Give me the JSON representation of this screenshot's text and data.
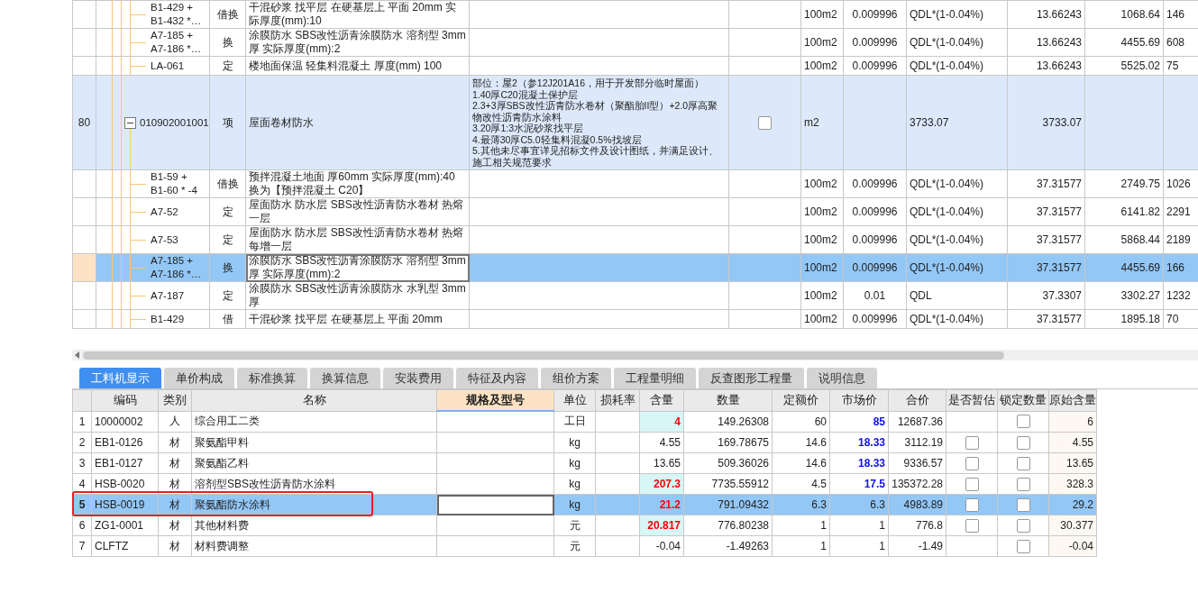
{
  "top_table": {
    "rows": [
      {
        "kind": "sub",
        "selected": false,
        "code": "B1-429 +\nB1-432 *…",
        "type": "借换",
        "name": "干混砂浆 找平层 在硬基层上 平面 20mm  实际厚度(mm):10",
        "unit": "100m2",
        "content": "0.009996",
        "formula": "QDL*(1-0.04%)",
        "quantity": "13.66243",
        "price": "1068.64",
        "total": "146"
      },
      {
        "kind": "sub",
        "selected": false,
        "code": "A7-185 +\nA7-186 *…",
        "type": "换",
        "name": "涂膜防水 SBS改性沥青涂膜防水 溶剂型 3mm厚  实际厚度(mm):2",
        "unit": "100m2",
        "content": "0.009996",
        "formula": "QDL*(1-0.04%)",
        "quantity": "13.66243",
        "price": "4455.69",
        "total": "608"
      },
      {
        "kind": "sub",
        "selected": false,
        "code": "LA-061",
        "type": "定",
        "name": "楼地面保温 轻集料混凝土 厚度(mm) 100",
        "unit": "100m2",
        "content": "0.009996",
        "formula": "QDL*(1-0.04%)",
        "quantity": "13.66243",
        "price": "5525.02",
        "total": "75"
      },
      {
        "kind": "item",
        "selected": false,
        "expanded": true,
        "number": "80",
        "code": "010902001001",
        "type": "项",
        "name": "屋面卷材防水",
        "description": "部位：屋2（参12J201A16，用于开发部分临时屋面）\n1.40厚C20混凝土保护层\n2.3+3厚SBS改性沥青防水卷材（聚酯胎II型）+2.0厚高聚物改性沥青防水涂料\n3.20厚1:3水泥砂浆找平层\n4.最薄30厚C5.0轻集料混凝0.5%找坡层\n5.其他未尽事宜详见招标文件及设计图纸，并满足设计、施工相关规范要求",
        "checked": false,
        "unit": "m2",
        "formula": "3733.07",
        "quantity": "3733.07"
      },
      {
        "kind": "sub",
        "selected": false,
        "code": "B1-59 +\nB1-60 * -4",
        "type": "借换",
        "name": "预拌混凝土地面 厚60mm  实际厚度(mm):40 换为【预拌混凝土 C20】",
        "unit": "100m2",
        "content": "0.009996",
        "formula": "QDL*(1-0.04%)",
        "quantity": "37.31577",
        "price": "2749.75",
        "total": "1026"
      },
      {
        "kind": "sub",
        "selected": false,
        "code": "A7-52",
        "type": "定",
        "name": "屋面防水 防水层 SBS改性沥青防水卷材 热熔一层",
        "unit": "100m2",
        "content": "0.009996",
        "formula": "QDL*(1-0.04%)",
        "quantity": "37.31577",
        "price": "6141.82",
        "total": "2291"
      },
      {
        "kind": "sub",
        "selected": false,
        "code": "A7-53",
        "type": "定",
        "name": "屋面防水 防水层 SBS改性沥青防水卷材 热熔每增一层",
        "unit": "100m2",
        "content": "0.009996",
        "formula": "QDL*(1-0.04%)",
        "quantity": "37.31577",
        "price": "5868.44",
        "total": "2189"
      },
      {
        "kind": "sub",
        "selected": true,
        "code": "A7-185 +\nA7-186 *…",
        "type": "换",
        "name": "涂膜防水 SBS改性沥青涂膜防水 溶剂型 3mm厚  实际厚度(mm):2",
        "unit": "100m2",
        "content": "0.009996",
        "formula": "QDL*(1-0.04%)",
        "quantity": "37.31577",
        "price": "4455.69",
        "total": "166"
      },
      {
        "kind": "sub",
        "selected": false,
        "code": "A7-187",
        "type": "定",
        "name": "涂膜防水 SBS改性沥青涂膜防水 水乳型 3mm厚",
        "unit": "100m2",
        "content": "0.01",
        "formula": "QDL",
        "quantity": "37.3307",
        "price": "3302.27",
        "total": "1232"
      },
      {
        "kind": "sub",
        "selected": false,
        "code": "B1-429",
        "type": "借",
        "name": "干混砂浆 找平层 在硬基层上 平面 20mm",
        "unit": "100m2",
        "content": "0.009996",
        "formula": "QDL*(1-0.04%)",
        "quantity": "37.31577",
        "price": "1895.18",
        "total": "70"
      }
    ]
  },
  "tabs": [
    {
      "label": "工料机显示",
      "selected": true
    },
    {
      "label": "单价构成",
      "selected": false
    },
    {
      "label": "标准换算",
      "selected": false
    },
    {
      "label": "换算信息",
      "selected": false
    },
    {
      "label": "安装费用",
      "selected": false
    },
    {
      "label": "特征及内容",
      "selected": false
    },
    {
      "label": "组价方案",
      "selected": false
    },
    {
      "label": "工程量明细",
      "selected": false
    },
    {
      "label": "反查图形工程量",
      "selected": false
    },
    {
      "label": "说明信息",
      "selected": false
    }
  ],
  "resource_table": {
    "columns": [
      {
        "label": "编码",
        "selected": false
      },
      {
        "label": "类别",
        "selected": false
      },
      {
        "label": "名称",
        "selected": false
      },
      {
        "label": "规格及型号",
        "selected": true
      },
      {
        "label": "单位",
        "selected": false
      },
      {
        "label": "损耗率",
        "selected": false
      },
      {
        "label": "含量",
        "selected": false
      },
      {
        "label": "数量",
        "selected": false
      },
      {
        "label": "定额价",
        "selected": false
      },
      {
        "label": "市场价",
        "selected": false
      },
      {
        "label": "合价",
        "selected": false
      },
      {
        "label": "是否暂估",
        "selected": false
      },
      {
        "label": "锁定数量",
        "selected": false
      },
      {
        "label": "原始含量",
        "selected": false
      }
    ],
    "rows": [
      {
        "number": "1",
        "code": "10000002",
        "type": "人",
        "name": "综合用工二类",
        "unit": "工日",
        "content": "4",
        "content_changed": true,
        "quantity": "149.26308",
        "quota_price": "60",
        "market_price": "85",
        "price_changed": true,
        "total": "12687.36",
        "locked": false,
        "original": "6",
        "selected": false,
        "outlined": false
      },
      {
        "number": "2",
        "code": "EB1-0126",
        "type": "材",
        "name": "聚氨酯甲料",
        "unit": "kg",
        "content": "4.55",
        "content_changed": false,
        "quantity": "169.78675",
        "quota_price": "14.6",
        "market_price": "18.33",
        "price_changed": true,
        "total": "3112.19",
        "provisional": false,
        "locked": false,
        "original": "4.55",
        "selected": false,
        "outlined": false
      },
      {
        "number": "3",
        "code": "EB1-0127",
        "type": "材",
        "name": "聚氨酯乙料",
        "unit": "kg",
        "content": "13.65",
        "content_changed": false,
        "quantity": "509.36026",
        "quota_price": "14.6",
        "market_price": "18.33",
        "price_changed": true,
        "total": "9336.57",
        "provisional": false,
        "locked": false,
        "original": "13.65",
        "selected": false,
        "outlined": false
      },
      {
        "number": "4",
        "code": "HSB-0020",
        "type": "材",
        "name": "溶剂型SBS改性沥青防水涂料",
        "unit": "kg",
        "content": "207.3",
        "content_changed": true,
        "quantity": "7735.55912",
        "quota_price": "4.5",
        "market_price": "17.5",
        "price_changed": true,
        "total": "135372.28",
        "provisional": false,
        "locked": false,
        "original": "328.3",
        "selected": false,
        "outlined": false
      },
      {
        "number": "5",
        "code": "HSB-0019",
        "type": "材",
        "name": "聚氨酯防水涂料",
        "unit": "kg",
        "content": "21.2",
        "content_changed": true,
        "quantity": "791.09432",
        "quota_price": "6.3",
        "market_price": "6.3",
        "price_changed": false,
        "total": "4983.89",
        "provisional": false,
        "locked": false,
        "original": "29.2",
        "selected": true,
        "outlined": true
      },
      {
        "number": "6",
        "code": "ZG1-0001",
        "type": "材",
        "name": "其他材料费",
        "unit": "元",
        "content": "20.817",
        "content_changed": true,
        "quantity": "776.80238",
        "quota_price": "1",
        "market_price": "1",
        "price_changed": false,
        "total": "776.8",
        "provisional": false,
        "locked": false,
        "original": "30.377",
        "selected": false,
        "outlined": false
      },
      {
        "number": "7",
        "code": "CLFTZ",
        "type": "材",
        "name": "材料费调整",
        "unit": "元",
        "content": "-0.04",
        "content_changed": false,
        "quantity": "-1.49263",
        "quota_price": "1",
        "market_price": "1",
        "price_changed": false,
        "total": "-1.49",
        "locked": false,
        "original": "-0.04",
        "selected": false,
        "outlined": false
      }
    ]
  }
}
